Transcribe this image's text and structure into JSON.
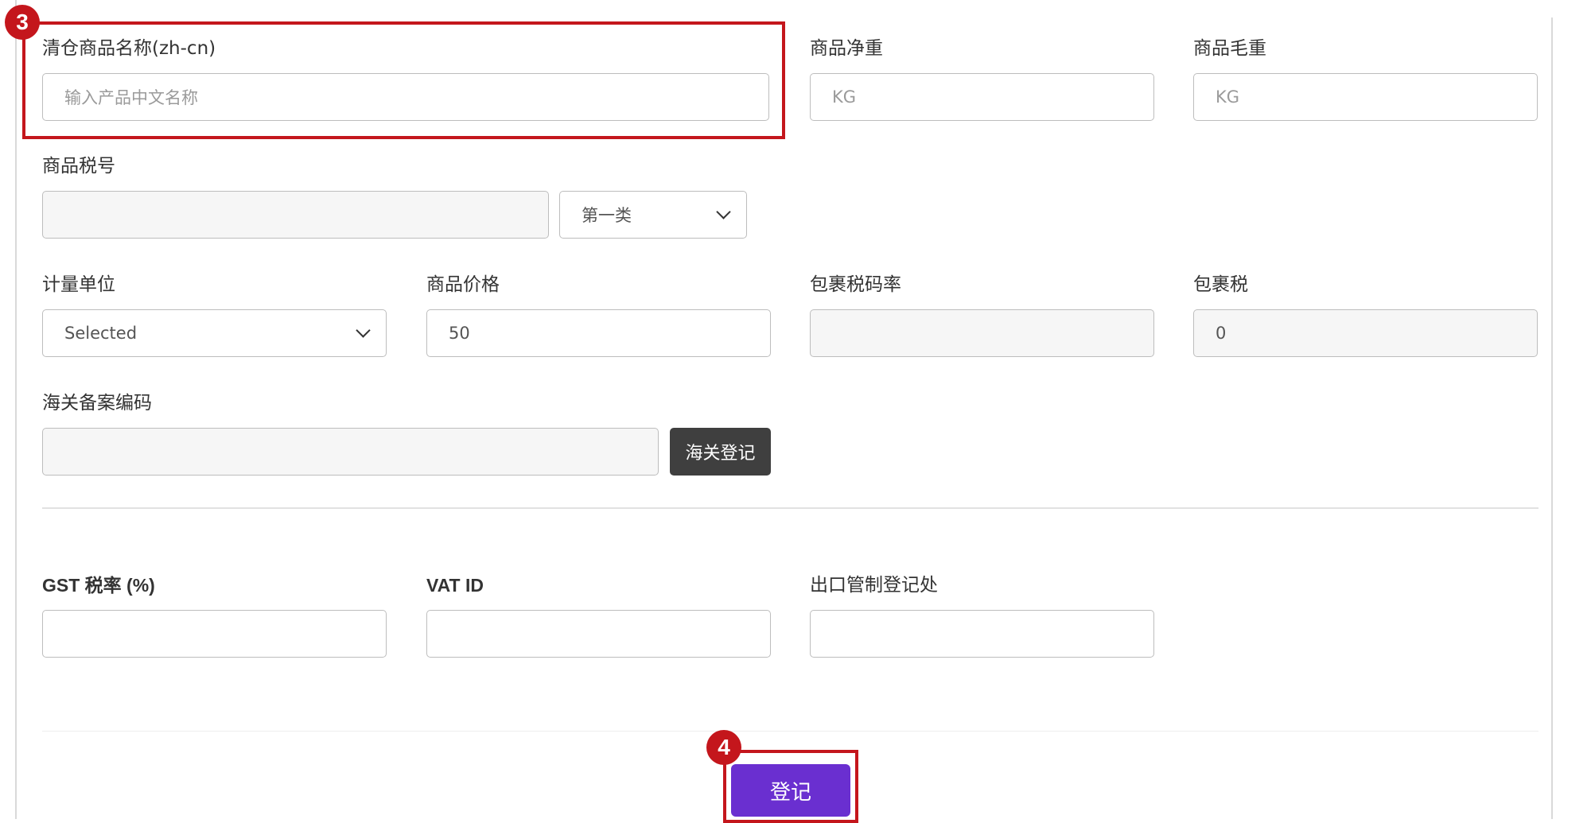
{
  "annotations": {
    "step3": "3",
    "step4": "4",
    "highlight_color": "#c4161c"
  },
  "fields": {
    "clearance_name": {
      "label": "清仓商品名称(zh-cn)",
      "placeholder": "输入产品中文名称",
      "value": ""
    },
    "net_weight": {
      "label": "商品净重",
      "placeholder": "KG",
      "value": ""
    },
    "gross_weight": {
      "label": "商品毛重",
      "placeholder": "KG",
      "value": ""
    },
    "tax_number": {
      "label": "商品税号",
      "value": "",
      "category_selected": "第一类"
    },
    "unit": {
      "label": "计量单位",
      "selected": "Selected"
    },
    "price": {
      "label": "商品价格",
      "value": "50"
    },
    "parcel_tax_rate": {
      "label": "包裹税码率",
      "value": ""
    },
    "parcel_tax": {
      "label": "包裹税",
      "value": "0"
    },
    "customs_code": {
      "label": "海关备案编码",
      "value": "",
      "button_label": "海关登记"
    },
    "gst_rate": {
      "label": "GST 税率 (%)",
      "value": ""
    },
    "vat_id": {
      "label": "VAT ID",
      "value": ""
    },
    "export_control": {
      "label": "出口管制登记处",
      "value": ""
    }
  },
  "submit": {
    "label": "登记",
    "color": "#6a2fd0"
  }
}
